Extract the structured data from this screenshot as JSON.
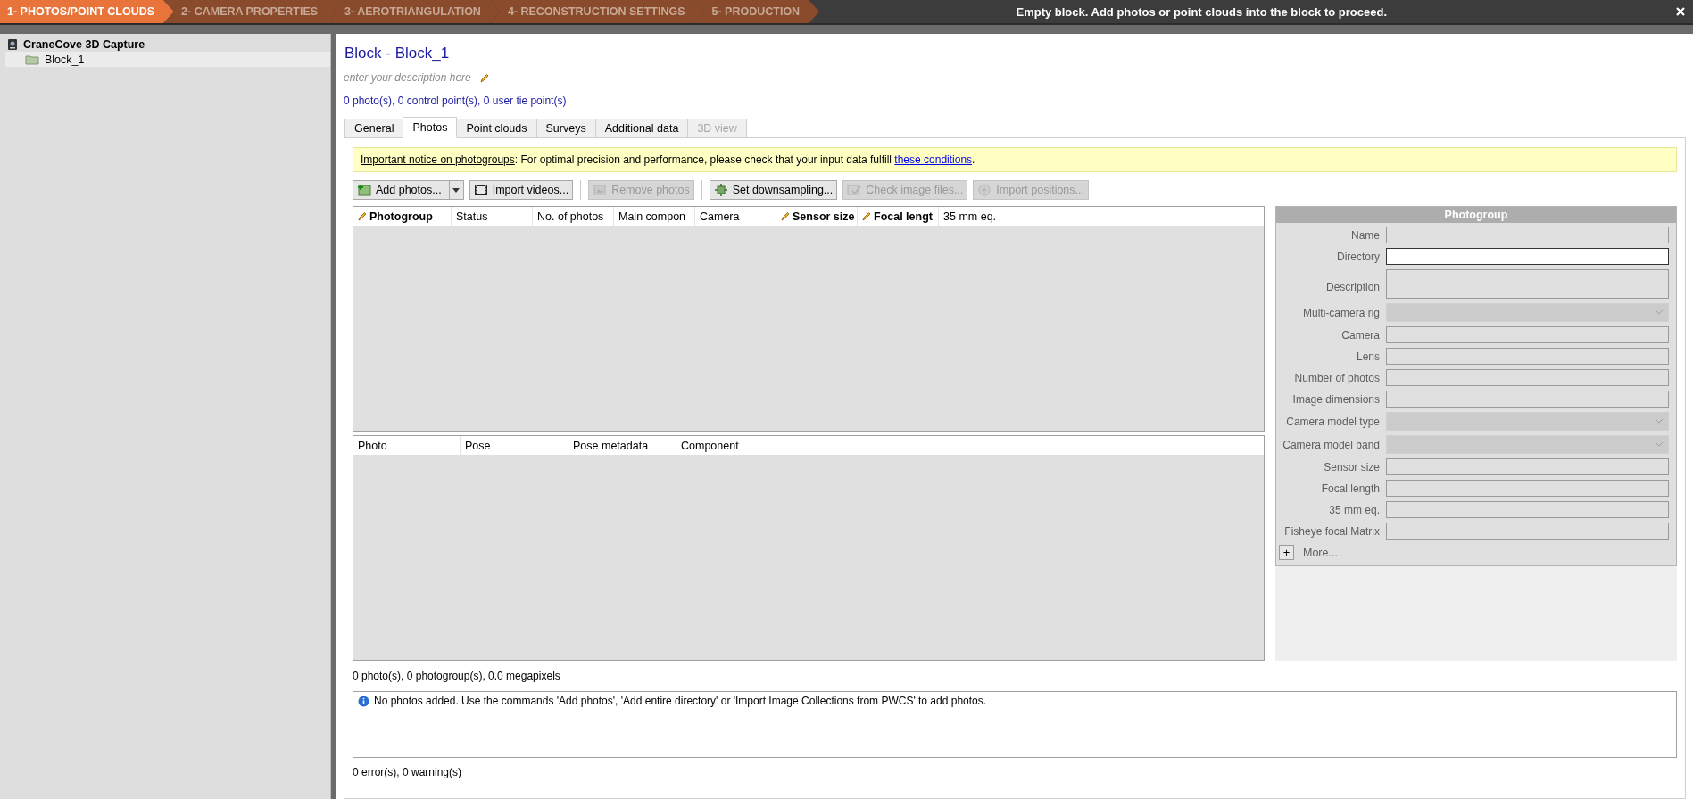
{
  "steps": [
    {
      "label": "1- PHOTOS/POINT CLOUDS",
      "selected": true
    },
    {
      "label": "2- CAMERA PROPERTIES",
      "selected": false
    },
    {
      "label": "3- AEROTRIANGULATION",
      "selected": false
    },
    {
      "label": "4- RECONSTRUCTION SETTINGS",
      "selected": false
    },
    {
      "label": "5- PRODUCTION",
      "selected": false
    }
  ],
  "status_message": "Empty block. Add photos or point clouds into the block to proceed.",
  "tree": [
    {
      "label": "CraneCove 3D Capture",
      "selected": false,
      "children": [
        {
          "label": "Block_1",
          "selected": true
        }
      ]
    }
  ],
  "block": {
    "title": "Block - Block_1",
    "placeholder": "enter your description here",
    "counts": "0 photo(s), 0 control point(s), 0 user tie point(s)"
  },
  "tabs": [
    {
      "label": "General",
      "selected": false,
      "disabled": false
    },
    {
      "label": "Photos",
      "selected": true,
      "disabled": false
    },
    {
      "label": "Point clouds",
      "selected": false,
      "disabled": false
    },
    {
      "label": "Surveys",
      "selected": false,
      "disabled": false
    },
    {
      "label": "Additional data",
      "selected": false,
      "disabled": false
    },
    {
      "label": "3D view",
      "selected": false,
      "disabled": true
    }
  ],
  "notice": {
    "link": "Important notice on photogroups",
    "text": ": For optimal precision and performance, please check that your input data fulfill ",
    "link2": "these conditions",
    "end": "."
  },
  "toolbar": [
    {
      "label": "Add photos...",
      "kind": "add",
      "dropdown": true,
      "disabled": false
    },
    {
      "label": "Import videos...",
      "kind": "film",
      "dropdown": false,
      "disabled": false
    },
    {
      "label": "Remove photos",
      "kind": "remove",
      "dropdown": false,
      "disabled": true
    },
    {
      "label": "Set downsampling...",
      "kind": "downsample",
      "dropdown": false,
      "disabled": false
    },
    {
      "label": "Check image files...",
      "kind": "check",
      "dropdown": false,
      "disabled": true
    },
    {
      "label": "Import positions...",
      "kind": "import",
      "dropdown": false,
      "disabled": true
    }
  ],
  "photogroups_table": {
    "columns": [
      {
        "label": "Photogroup",
        "editable": true
      },
      {
        "label": "Status",
        "editable": false
      },
      {
        "label": "No. of photos",
        "editable": false
      },
      {
        "label": "Main compon",
        "editable": false
      },
      {
        "label": "Camera",
        "editable": false
      },
      {
        "label": "Sensor size",
        "editable": true
      },
      {
        "label": "Focal lengt",
        "editable": true
      },
      {
        "label": "35 mm eq.",
        "editable": false
      }
    ]
  },
  "photos_table": {
    "columns": [
      {
        "label": "Photo"
      },
      {
        "label": "Pose"
      },
      {
        "label": "Pose metadata"
      },
      {
        "label": "Component"
      }
    ]
  },
  "photogroup_panel": {
    "title": "Photogroup",
    "fields": [
      {
        "label": "Name",
        "kind": "text",
        "disabled": true
      },
      {
        "label": "Directory",
        "kind": "text",
        "disabled": false
      },
      {
        "label": "Description",
        "kind": "multiline",
        "disabled": true
      },
      {
        "label": "Multi-camera rig",
        "kind": "dropdown",
        "disabled": true
      },
      {
        "label": "Camera",
        "kind": "text",
        "disabled": true
      },
      {
        "label": "Lens",
        "kind": "text",
        "disabled": true
      },
      {
        "label": "Number of photos",
        "kind": "text",
        "disabled": true
      },
      {
        "label": "Image dimensions",
        "kind": "text",
        "disabled": true
      },
      {
        "label": "Camera model type",
        "kind": "dropdown",
        "disabled": true
      },
      {
        "label": "Camera model band",
        "kind": "dropdown",
        "disabled": true
      },
      {
        "label": "Sensor size",
        "kind": "text",
        "disabled": true
      },
      {
        "label": "Focal length",
        "kind": "text",
        "disabled": true
      },
      {
        "label": "35 mm eq.",
        "kind": "text",
        "disabled": true
      },
      {
        "label": "Fisheye focal Matrix",
        "kind": "text",
        "disabled": true
      }
    ],
    "expand": "+",
    "more": "More..."
  },
  "summary": "0 photo(s), 0 photogroup(s), 0.0 megapixels",
  "messages": [
    {
      "kind": "info",
      "text": "No photos added. Use the commands 'Add photos', 'Add entire directory' or 'Import Image Collections from PWCS' to add photos."
    }
  ],
  "footer": "0 error(s), 0 warning(s)"
}
